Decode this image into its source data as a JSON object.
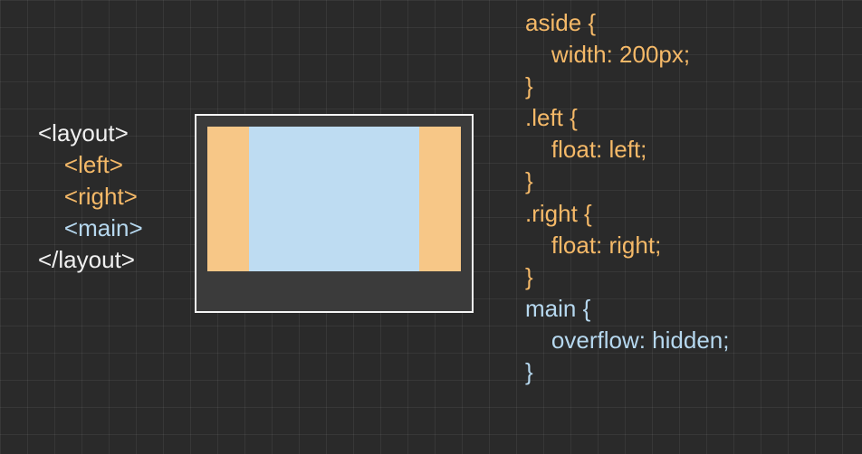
{
  "html": {
    "open": "<layout>",
    "left": "<left>",
    "right": "<right>",
    "main": "<main>",
    "close": "</layout>"
  },
  "css": {
    "r1": "aside {",
    "r2": "width: 200px;",
    "r3": "}",
    "r4": ".left {",
    "r5": "float: left;",
    "r6": "}",
    "r7": ".right {",
    "r8": "float: right;",
    "r9": "}",
    "r10": "main {",
    "r11": "overflow: hidden;",
    "r12": "}"
  }
}
